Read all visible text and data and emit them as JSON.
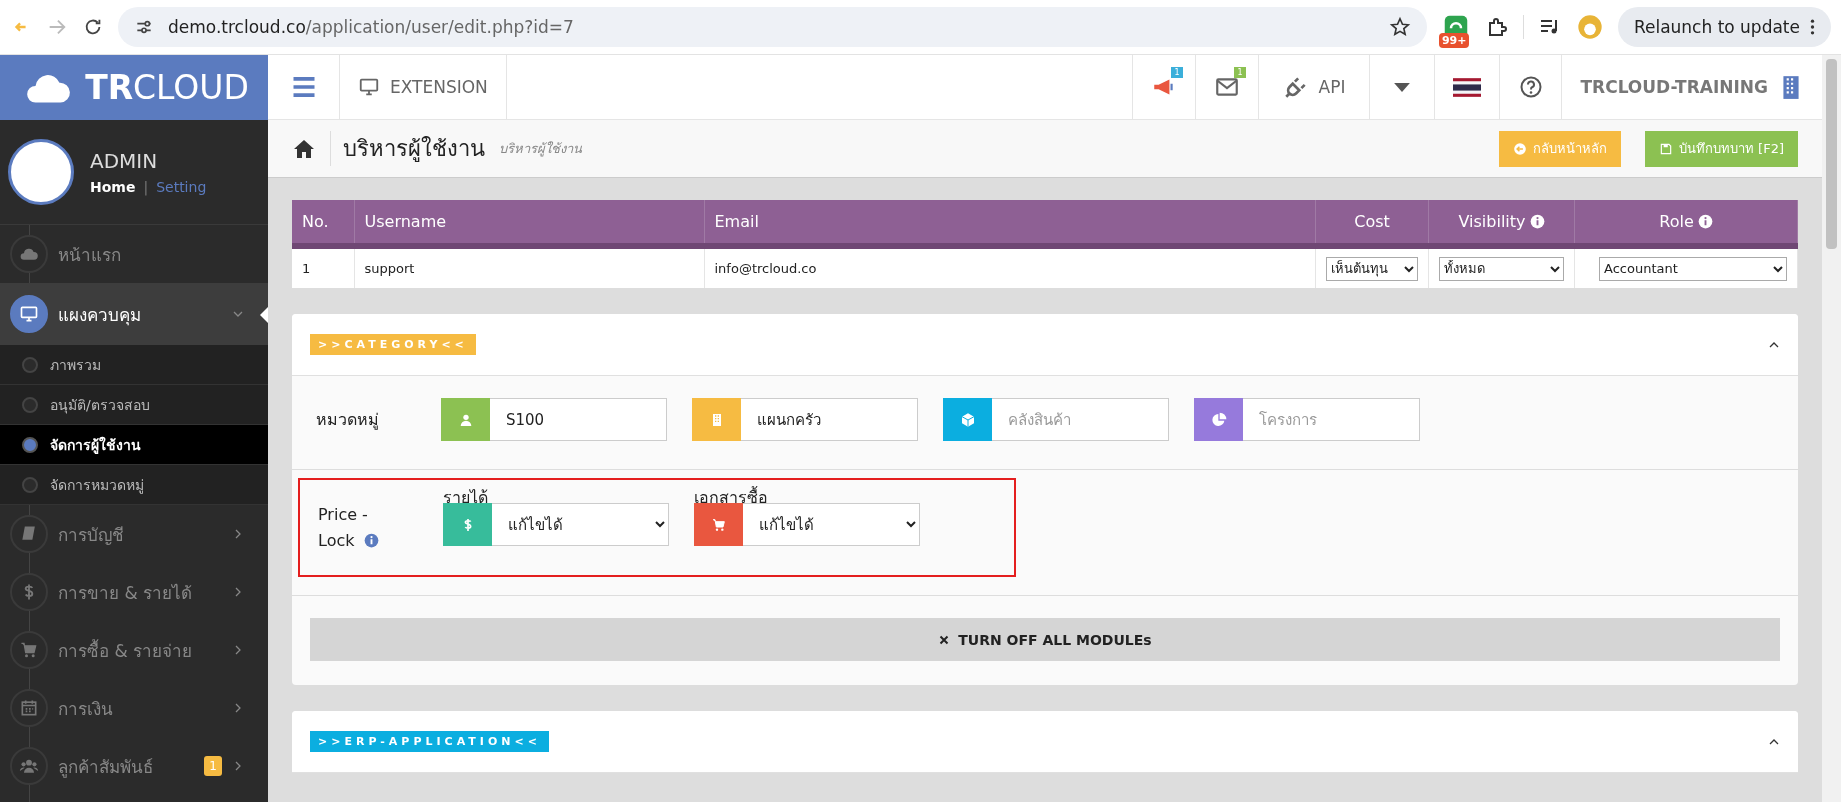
{
  "browser": {
    "url_host": "demo.trcloud.co",
    "url_path": "/application/user/edit.php?id=7",
    "extension_badge": "99+",
    "relaunch": "Relaunch to update"
  },
  "sidebar": {
    "logo_bold": "TR",
    "logo_light": "CLOUD",
    "user_name": "ADMIN",
    "home_link": "Home",
    "separator": "|",
    "setting_link": "Setting",
    "menu": [
      {
        "label": "หน้าแรก",
        "selected": false,
        "has_arrow": false
      },
      {
        "label": "แผงควบคุม",
        "selected": true,
        "expanded": true,
        "has_arrow": true,
        "children": [
          {
            "label": "ภาพรวม",
            "selected": false
          },
          {
            "label": "อนุมัติ/ตรวจสอบ",
            "selected": false
          },
          {
            "label": "จัดการผู้ใช้งาน",
            "selected": true
          },
          {
            "label": "จัดการหมวดหมู่",
            "selected": false
          }
        ]
      },
      {
        "label": "การบัญชี",
        "selected": false,
        "has_arrow": true
      },
      {
        "label": "การขาย & รายได้",
        "selected": false,
        "has_arrow": true
      },
      {
        "label": "การซื้อ & รายจ่าย",
        "selected": false,
        "has_arrow": true
      },
      {
        "label": "การเงิน",
        "selected": false,
        "has_arrow": true
      },
      {
        "label": "ลูกค้าสัมพันธ์",
        "selected": false,
        "has_arrow": true,
        "badge": "1"
      }
    ]
  },
  "topbar": {
    "extension": "EXTENSION",
    "announce_badge": "1",
    "mail_badge": "1",
    "api": "API",
    "company": "TRCLOUD-TRAINING"
  },
  "page": {
    "title": "บริหารผู้ใช้งาน",
    "subtitle": "บริหารผู้ใช้งาน",
    "buttons": [
      {
        "label": "กลับหน้าหลัก",
        "kind": "back"
      },
      {
        "label": "บันทึกบทบาท [F2]",
        "kind": "save"
      }
    ]
  },
  "table": {
    "columns": [
      {
        "label": "No."
      },
      {
        "label": "Username"
      },
      {
        "label": "Email"
      },
      {
        "label": "Cost"
      },
      {
        "label": "Visibility",
        "info": true
      },
      {
        "label": "Role",
        "info": true
      }
    ],
    "rows": [
      {
        "no": "1",
        "username": "support",
        "email": "info@trcloud.co",
        "cost": "เห็นต้นทุน",
        "visibility": "ทั้งหมด",
        "role": "Accountant"
      }
    ]
  },
  "category": {
    "tag": ">>CATEGORY<<",
    "row_label": "หมวดหมู่",
    "fields": [
      {
        "value": "S100",
        "color": "#8cc152"
      },
      {
        "value": "แผนกครัว",
        "color": "#f6bb42"
      },
      {
        "placeholder": "คลังสินค้า",
        "color": "#0baee0"
      },
      {
        "placeholder": "โครงการ",
        "color": "#967adc"
      }
    ],
    "price_lock": {
      "label": "Price - Lock",
      "highlighted": true,
      "fields": [
        {
          "label": "รายได้",
          "value": "แก้ไขได้",
          "color": "#37bc9b"
        },
        {
          "label": "เอกสารซื้อ",
          "value": "แก้ไขได้",
          "color": "#e9573f"
        }
      ]
    },
    "turn_off_button": "TURN OFF ALL MODULEs"
  },
  "erp": {
    "tag": ">>ERP-APPLICATION<<"
  }
}
